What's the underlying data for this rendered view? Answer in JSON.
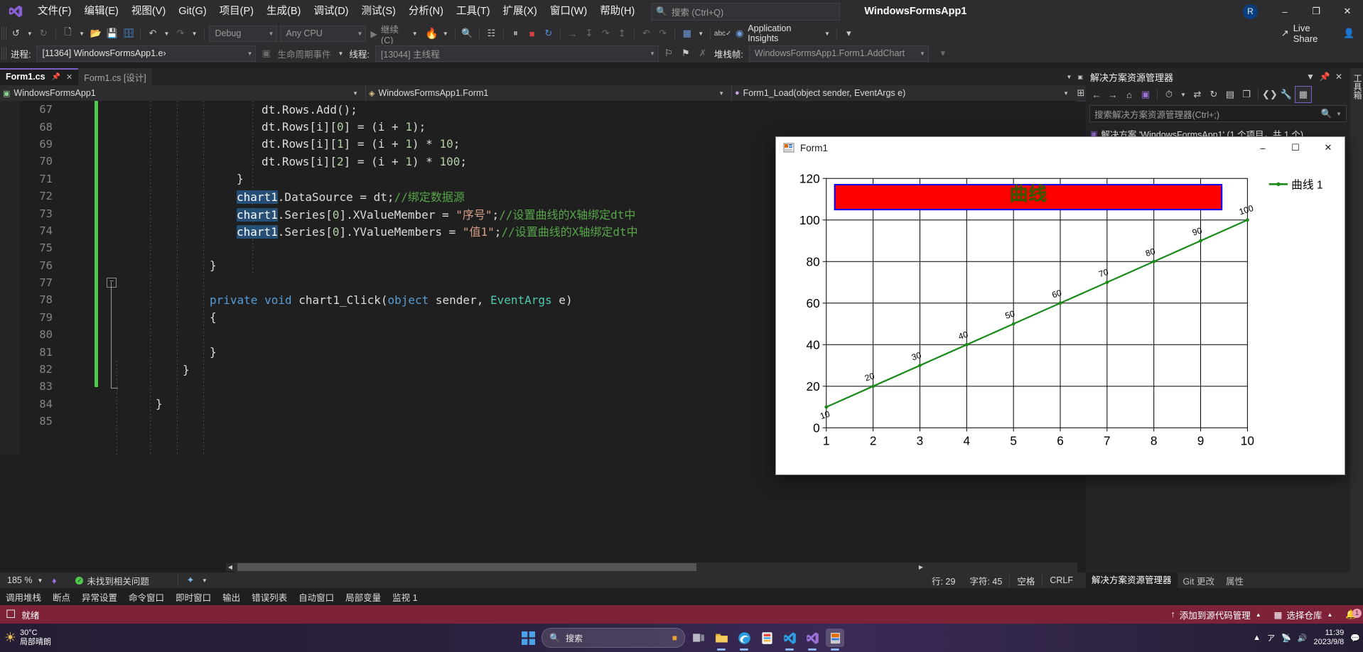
{
  "titlebar": {
    "logo_icon": "visual-studio-logo",
    "menu": [
      {
        "label": "文件(F)"
      },
      {
        "label": "编辑(E)"
      },
      {
        "label": "视图(V)"
      },
      {
        "label": "Git(G)"
      },
      {
        "label": "项目(P)"
      },
      {
        "label": "生成(B)"
      },
      {
        "label": "调试(D)"
      },
      {
        "label": "测试(S)"
      },
      {
        "label": "分析(N)"
      },
      {
        "label": "工具(T)"
      },
      {
        "label": "扩展(X)"
      },
      {
        "label": "窗口(W)"
      },
      {
        "label": "帮助(H)"
      }
    ],
    "search_placeholder": "搜索 (Ctrl+Q)",
    "project_title": "WindowsFormsApp1",
    "avatar_initial": "R",
    "minimize": "–",
    "maximize": "❐",
    "close": "✕"
  },
  "toolbar": {
    "config_value": "Debug",
    "platform_value": "Any CPU",
    "run_label": "继续(C)",
    "liveshare_label": "Live Share"
  },
  "debugbar": {
    "process_label": "进程:",
    "process_value": "[11364] WindowsFormsApp1.e›",
    "lifecycle_label": "生命周期事件",
    "thread_label": "线程:",
    "thread_value": "[13044] 主线程",
    "stack_label": "堆栈帧:",
    "stack_value": "WindowsFormsApp1.Form1.AddChart"
  },
  "tabs": [
    {
      "label": "Form1.cs",
      "active": true
    },
    {
      "label": "Form1.cs [设计]",
      "active": false
    }
  ],
  "breadcrumb": [
    {
      "label": "WindowsFormsApp1",
      "icon": "csharp-project-icon"
    },
    {
      "label": "WindowsFormsApp1.Form1",
      "icon": "class-icon"
    },
    {
      "label": "Form1_Load(object sender, EventArgs e)",
      "icon": "method-icon"
    }
  ],
  "editor": {
    "first_line": 67,
    "lines": [
      {
        "n": 67,
        "text": "dt.Rows.Add();"
      },
      {
        "n": 68,
        "text": "dt.Rows[i][0] = (i + 1);"
      },
      {
        "n": 69,
        "text": "dt.Rows[i][1] = (i + 1) * 10;"
      },
      {
        "n": 70,
        "text": "dt.Rows[i][2] = (i + 1) * 100;"
      },
      {
        "n": 71,
        "text": "}"
      },
      {
        "n": 72,
        "text": "chart1.DataSource = dt;//绑定数据源"
      },
      {
        "n": 73,
        "text": "chart1.Series[0].XValueMember = \"序号\";//设置曲线的X轴绑定dt中"
      },
      {
        "n": 74,
        "text": "chart1.Series[0].YValueMembers = \"值1\";//设置曲线的X轴绑定dt中"
      },
      {
        "n": 75,
        "text": ""
      },
      {
        "n": 76,
        "text": "}"
      },
      {
        "n": 77,
        "text": ""
      },
      {
        "n": 78,
        "text": "private void chart1_Click(object sender, EventArgs e)"
      },
      {
        "n": 79,
        "text": "{"
      },
      {
        "n": 80,
        "text": ""
      },
      {
        "n": 81,
        "text": "}"
      },
      {
        "n": 82,
        "text": "}"
      },
      {
        "n": 83,
        "text": ""
      },
      {
        "n": 84,
        "text": "}"
      },
      {
        "n": 85,
        "text": ""
      }
    ]
  },
  "editor_status": {
    "zoom": "185 %",
    "issues": "未找到相关问题",
    "line": "行: 29",
    "char": "字符: 45",
    "spaces": "空格",
    "eol": "CRLF"
  },
  "bottom_tabs": [
    {
      "label": "调用堆栈"
    },
    {
      "label": "断点"
    },
    {
      "label": "异常设置"
    },
    {
      "label": "命令窗口"
    },
    {
      "label": "即时窗口"
    },
    {
      "label": "输出"
    },
    {
      "label": "错误列表"
    },
    {
      "label": "自动窗口"
    },
    {
      "label": "局部变量"
    },
    {
      "label": "监视 1"
    }
  ],
  "solution_explorer": {
    "title": "解决方案资源管理器",
    "search_placeholder": "搜索解决方案资源管理器(Ctrl+;)",
    "root_node": "解决方案 'WindowsFormsApp1' (1 个项目，共 1 个)",
    "vertical_tab": "工具箱"
  },
  "status_tabs": [
    {
      "label": "解决方案资源管理器",
      "active": true
    },
    {
      "label": "Git 更改",
      "active": false
    },
    {
      "label": "属性",
      "active": false
    }
  ],
  "vs_status": {
    "ready": "就绪",
    "add_source_control": "添加到源代码管理",
    "select_repo": "选择仓库",
    "notification_count": "1"
  },
  "form_window": {
    "title": "Form1",
    "minimize": "–",
    "maximize": "☐",
    "close": "✕"
  },
  "chart_data": {
    "type": "line",
    "title": "曲线",
    "title_color": "#008000",
    "title_background": "#ff0000",
    "title_border_color": "#0000ff",
    "series_color": "#1a8a1a",
    "x": [
      1,
      2,
      3,
      4,
      5,
      6,
      7,
      8,
      9,
      10
    ],
    "values": [
      10,
      20,
      30,
      40,
      50,
      60,
      70,
      80,
      90,
      100
    ],
    "point_labels": [
      "10",
      "20",
      "30",
      "40",
      "50",
      "60",
      "70",
      "80",
      "90",
      "100"
    ],
    "xticklabels": [
      "1",
      "2",
      "3",
      "4",
      "5",
      "6",
      "7",
      "8",
      "9",
      "10"
    ],
    "yticklabels": [
      "0",
      "20",
      "40",
      "60",
      "80",
      "100",
      "120"
    ],
    "yticks": [
      0,
      20,
      40,
      60,
      80,
      100,
      120
    ],
    "ylim": [
      0,
      120
    ],
    "xlim": [
      1,
      10
    ],
    "xlabel": "",
    "ylabel": "",
    "grid": true,
    "legend": [
      {
        "name": "曲线 1",
        "color": "#1a8a1a"
      }
    ],
    "legend_position": "top-right"
  },
  "taskbar": {
    "weather_temp": "30°C",
    "weather_desc": "局部晴朗",
    "search_placeholder": "搜索",
    "time": "11:39",
    "date": "2023/9/8"
  }
}
